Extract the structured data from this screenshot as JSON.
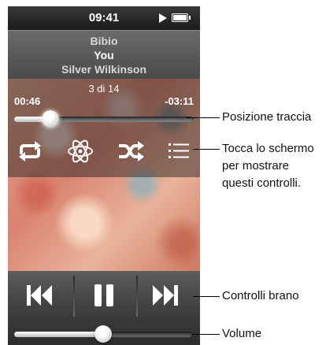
{
  "status_bar": {
    "time": "09:41",
    "play_icon": "play-triangle-icon",
    "battery_icon": "battery-icon"
  },
  "track": {
    "artist": "Bibio",
    "song": "You",
    "album": "Silver Wilkinson",
    "counter": "3 di 14"
  },
  "progress": {
    "elapsed": "00:46",
    "remaining": "-03:11",
    "position_fraction": 0.2
  },
  "controls": {
    "repeat": "repeat-icon",
    "genius": "atom-icon",
    "shuffle": "shuffle-icon",
    "list": "list-icon"
  },
  "playback": {
    "previous": "previous-track-icon",
    "pause": "pause-icon",
    "next": "next-track-icon"
  },
  "volume": {
    "level_fraction": 0.5
  },
  "callouts": {
    "position": "Posizione traccia",
    "tap_line1": "Tocca lo schermo",
    "tap_line2": "per mostrare",
    "tap_line3": "questi controlli.",
    "song_controls": "Controlli brano",
    "volume": "Volume"
  },
  "colors": {
    "screen_bg": "#1e1e1e",
    "trackinfo_bg": "#5a5a5a",
    "controls_bg": "#444444"
  }
}
